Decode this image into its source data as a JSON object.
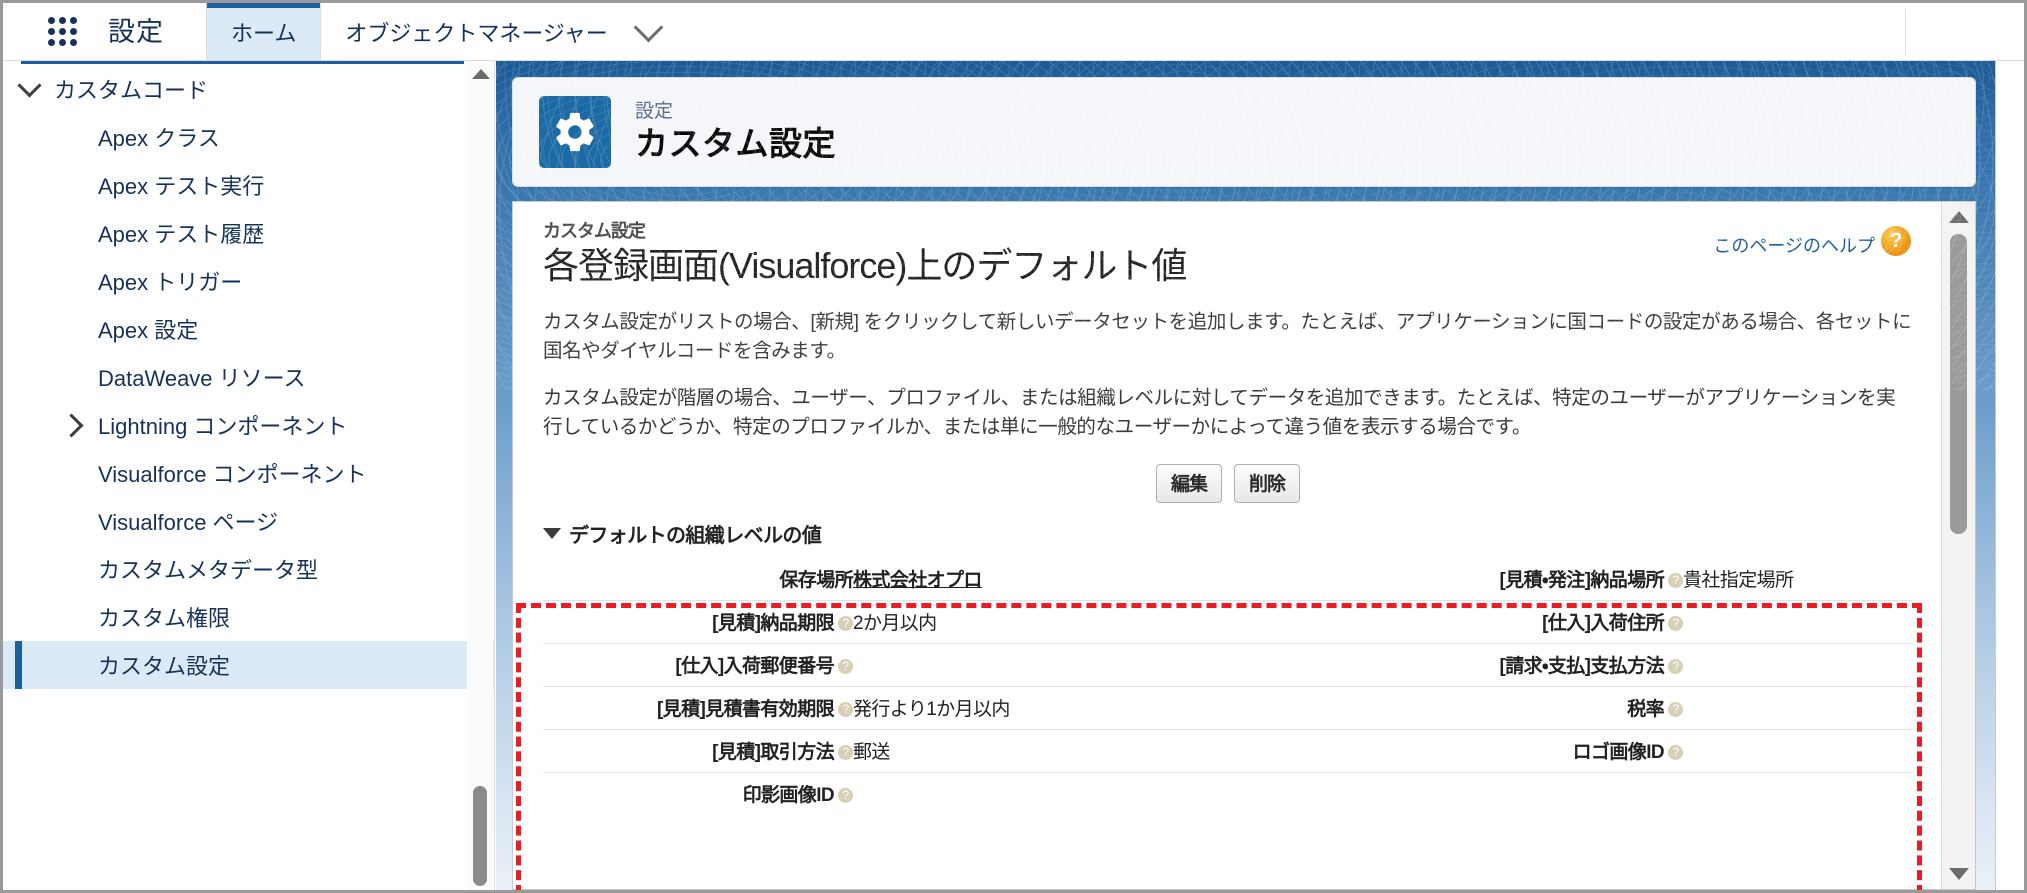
{
  "header": {
    "app_launcher_icon": "waffle-icon",
    "setup_label": "設定",
    "tabs": [
      {
        "label": "ホーム",
        "active": true
      },
      {
        "label": "オブジェクトマネージャー",
        "active": false
      }
    ],
    "dropdown_icon": "chevron-down-icon"
  },
  "sidebar": {
    "section": {
      "label": "カスタムコード",
      "caret": "chevron-down-icon",
      "expanded": true
    },
    "items": [
      {
        "label": "Apex クラス",
        "caret": null,
        "selected": false
      },
      {
        "label": "Apex テスト実行",
        "caret": null,
        "selected": false
      },
      {
        "label": "Apex テスト履歴",
        "caret": null,
        "selected": false
      },
      {
        "label": "Apex トリガー",
        "caret": null,
        "selected": false
      },
      {
        "label": "Apex 設定",
        "caret": null,
        "selected": false
      },
      {
        "label": "DataWeave リソース",
        "caret": null,
        "selected": false
      },
      {
        "label": "Lightning コンポーネント",
        "caret": "chevron-right-icon",
        "selected": false
      },
      {
        "label": "Visualforce コンポーネント",
        "caret": null,
        "selected": false
      },
      {
        "label": "Visualforce ページ",
        "caret": null,
        "selected": false
      },
      {
        "label": "カスタムメタデータ型",
        "caret": null,
        "selected": false
      },
      {
        "label": "カスタム権限",
        "caret": null,
        "selected": false
      },
      {
        "label": "カスタム設定",
        "caret": null,
        "selected": true
      }
    ]
  },
  "page_header": {
    "icon": "gear-icon",
    "eyebrow": "設定",
    "title": "カスタム設定"
  },
  "content": {
    "breadcrumb": "カスタム設定",
    "title": "各登録画面(Visualforce)上のデフォルト値",
    "help_link": "このページのヘルプ",
    "help_icon": "question-mark-icon",
    "paragraphs": [
      "カスタム設定がリストの場合、[新規] をクリックして新しいデータセットを追加します。たとえば、アプリケーションに国コードの設定がある場合、各セットに国名やダイヤルコードを含みます。",
      "カスタム設定が階層の場合、ユーザー、プロファイル、または組織レベルに対してデータを追加できます。たとえば、特定のユーザーがアプリケーションを実行しているかどうか、特定のプロファイルか、または単に一般的なユーザーかによって違う値を表示する場合です。"
    ],
    "buttons": [
      {
        "label": "編集",
        "name": "edit-button"
      },
      {
        "label": "削除",
        "name": "delete-button"
      }
    ],
    "detail_section": {
      "toggle_icon": "triangle-down-icon",
      "heading": "デフォルトの組織レベルの値",
      "rows": [
        {
          "left_label": "保存場所",
          "left_help": false,
          "left_value": "株式会社オプロ",
          "left_value_is_link": true,
          "right_label": "[見積・発注]納品場所",
          "right_help": true,
          "right_value": "貴社指定場所"
        },
        {
          "left_label": "[見積]納品期限",
          "left_help": true,
          "left_value": "2か月以内",
          "left_value_is_link": false,
          "right_label": "[仕入]入荷住所",
          "right_help": true,
          "right_value": ""
        },
        {
          "left_label": "[仕入]入荷郵便番号",
          "left_help": true,
          "left_value": "",
          "left_value_is_link": false,
          "right_label": "[請求・支払]支払方法",
          "right_help": true,
          "right_value": ""
        },
        {
          "left_label": "[見積]見積書有効期限",
          "left_help": true,
          "left_value": "発行より1か月以内",
          "left_value_is_link": false,
          "right_label": "税率",
          "right_help": true,
          "right_value": ""
        },
        {
          "left_label": "[見積]取引方法",
          "left_help": true,
          "left_value": "郵送",
          "left_value_is_link": false,
          "right_label": "ロゴ画像ID",
          "right_help": true,
          "right_value": ""
        },
        {
          "left_label": "印影画像ID",
          "left_help": true,
          "left_value": "",
          "left_value_is_link": false,
          "right_label": "",
          "right_help": false,
          "right_value": ""
        }
      ]
    }
  },
  "annotation": {
    "highlight_color": "#ec1c24",
    "style": "dashed-rectangle"
  },
  "colors": {
    "brand_blue": "#1b5f9e",
    "header_gradient_top": "#1c5b96",
    "selected_nav_bg": "#dbeaf6",
    "help_icon_orange": "#e8920f"
  }
}
